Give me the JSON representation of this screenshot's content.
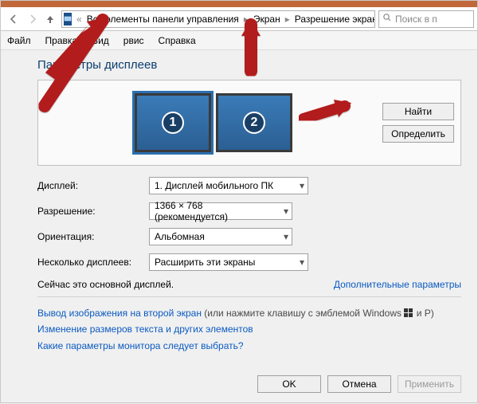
{
  "window_title": "Разрешение экрана",
  "addressbar": {
    "overflow": "«",
    "segments": [
      "Все элементы панели управления",
      "Экран",
      "Разрешение экрана"
    ]
  },
  "search": {
    "placeholder": "Поиск в п"
  },
  "menu": {
    "file": "Файл",
    "edit": "Правка",
    "view": "Вид",
    "tools": "рвис",
    "help": "Справка"
  },
  "heading": "Параметры дисплеев",
  "monitors": {
    "m1": "1",
    "m2": "2"
  },
  "panel_buttons": {
    "find": "Найти",
    "identify": "Определить"
  },
  "form": {
    "display_label": "Дисплей:",
    "display_value": "1. Дисплей мобильного ПК",
    "resolution_label": "Разрешение:",
    "resolution_value": "1366 × 768 (рекомендуется)",
    "orientation_label": "Ориентация:",
    "orientation_value": "Альбомная",
    "multi_label": "Несколько дисплеев:",
    "multi_value": "Расширить эти экраны"
  },
  "primary_text": "Сейчас это основной дисплей.",
  "advanced_link": "Дополнительные параметры",
  "info": {
    "second_screen_link": "Вывод изображения на второй экран",
    "second_screen_tail": " (или нажмите клавишу с эмблемой Windows ",
    "second_screen_tail2": " и P)",
    "text_size_link": "Изменение размеров текста и других элементов",
    "which_params_link": "Какие параметры монитора следует выбрать?"
  },
  "buttons": {
    "ok": "OK",
    "cancel": "Отмена",
    "apply": "Применить"
  }
}
